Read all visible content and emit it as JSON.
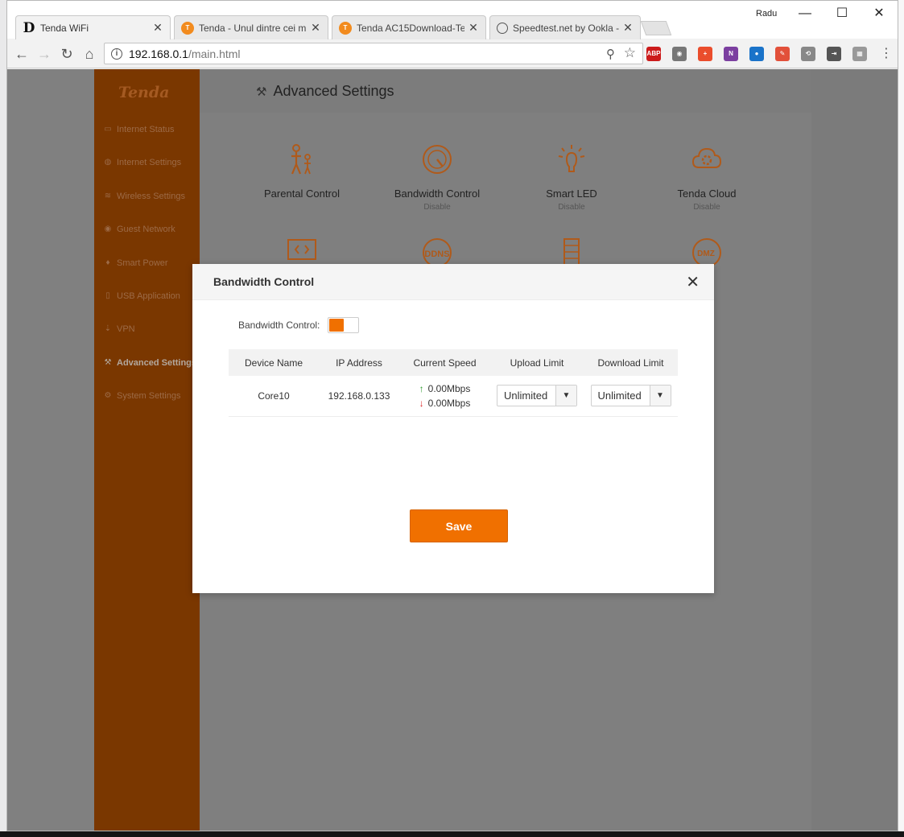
{
  "browser": {
    "profile_name": "Radu",
    "tabs": [
      {
        "label": "Tenda WiFi",
        "icon": "d-favicon",
        "active": true
      },
      {
        "label": "Tenda - Unul dintre cei m",
        "icon": "tenda-favicon",
        "active": false
      },
      {
        "label": "Tenda AC15Download-Te",
        "icon": "tenda-favicon",
        "active": false
      },
      {
        "label": "Speedtest.net by Ookla -",
        "icon": "speedtest-favicon",
        "active": false
      }
    ],
    "tab_close_glyph": "✕",
    "window_controls": {
      "minimize": "—",
      "maximize": "☐",
      "close": "✕"
    },
    "url_host": "192.168.0.1",
    "url_path": "/main.html",
    "nav": {
      "back": "←",
      "forward": "→",
      "reload": "↻",
      "home": "⌂"
    },
    "extensions": [
      {
        "name": "adblock-icon",
        "text": "ABP",
        "color": "#cc1b1b"
      },
      {
        "name": "camera-icon",
        "text": "◉",
        "color": "#777777"
      },
      {
        "name": "plus-extension-icon",
        "text": "+",
        "color": "#ea4d2c"
      },
      {
        "name": "onenote-icon",
        "text": "N",
        "color": "#7b3fa0"
      },
      {
        "name": "globe-extension-icon",
        "text": "●",
        "color": "#1a73c9"
      },
      {
        "name": "edit-extension-icon",
        "text": "✎",
        "color": "#e2503a"
      },
      {
        "name": "history-icon",
        "text": "⟲",
        "color": "#888888"
      },
      {
        "name": "pin-extension-icon",
        "text": "⇥",
        "color": "#555555"
      },
      {
        "name": "grid-extension-icon",
        "text": "▦",
        "color": "#999999"
      }
    ],
    "menu_glyph": "⋮"
  },
  "sidebar": {
    "logo": "Tenda",
    "items": [
      {
        "label": "Internet Status",
        "icon": "monitor-icon"
      },
      {
        "label": "Internet Settings",
        "icon": "globe-icon"
      },
      {
        "label": "Wireless Settings",
        "icon": "wifi-icon"
      },
      {
        "label": "Guest Network",
        "icon": "guest-icon"
      },
      {
        "label": "Smart Power",
        "icon": "bulb-icon"
      },
      {
        "label": "USB Application",
        "icon": "usb-icon"
      },
      {
        "label": "VPN",
        "icon": "vpn-icon"
      },
      {
        "label": "Advanced Settings",
        "icon": "wrench-icon",
        "active": true
      },
      {
        "label": "System Settings",
        "icon": "gear-icon"
      }
    ]
  },
  "page": {
    "title": "Advanced Settings"
  },
  "features": [
    {
      "label": "Parental Control",
      "status": "",
      "icon": "parental-icon"
    },
    {
      "label": "Bandwidth Control",
      "status": "Disable",
      "icon": "gauge-icon"
    },
    {
      "label": "Smart LED",
      "status": "Disable",
      "icon": "led-icon"
    },
    {
      "label": "Tenda Cloud",
      "status": "Disable",
      "icon": "cloud-icon"
    },
    {
      "label": "",
      "status": "",
      "icon": "screen-code-icon"
    },
    {
      "label": "",
      "status": "",
      "icon": "ddns-icon",
      "text": "DDNS"
    },
    {
      "label": "",
      "status": "",
      "icon": "server-icon"
    },
    {
      "label": "",
      "status": "",
      "icon": "dmz-icon",
      "text": "DMZ"
    }
  ],
  "modal": {
    "title": "Bandwidth Control",
    "close_glyph": "✕",
    "toggle_label": "Bandwidth Control:",
    "toggle_on": true,
    "table": {
      "headers": [
        "Device Name",
        "IP Address",
        "Current Speed",
        "Upload Limit",
        "Download Limit"
      ],
      "rows": [
        {
          "device": "Core10",
          "ip": "192.168.0.133",
          "upload_speed": "0.00Mbps",
          "download_speed": "0.00Mbps",
          "upload_limit": "Unlimited",
          "download_limit": "Unlimited"
        }
      ]
    },
    "save_label": "Save"
  },
  "colors": {
    "accent": "#f07000",
    "sidebar": "#7a3700",
    "overlay": "#808080"
  }
}
